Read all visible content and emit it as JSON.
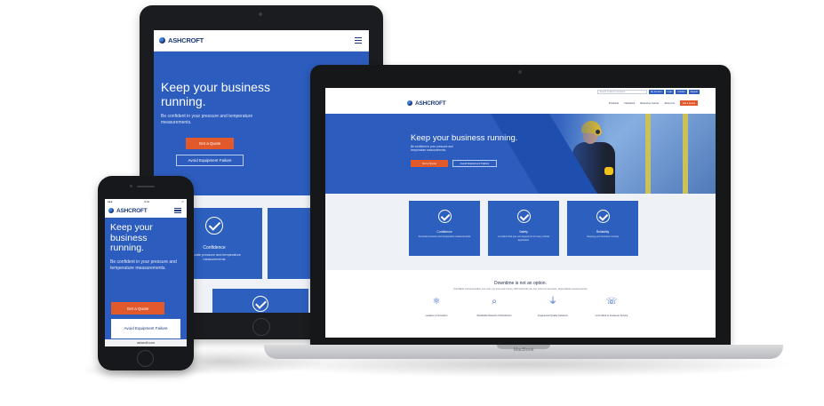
{
  "brand": {
    "logo_text": "ASHCROFT"
  },
  "hero": {
    "headline": "Keep your business running.",
    "headline_phone": "Keep your business running.",
    "subtext": "Be confident in your pressure and temperature measurements.",
    "cta_primary": "Get a Quote",
    "cta_secondary": "Avoid Equipment Failure"
  },
  "laptop_nav": {
    "search_placeholder": "Search product or keyword",
    "top_buttons": [
      "My Account",
      "Login",
      "Contact",
      "Support"
    ],
    "menu": [
      "Products",
      "Industries",
      "Resource Center",
      "About Us"
    ],
    "menu_cta": "Get a Quote"
  },
  "cards": [
    {
      "title": "Confidence",
      "desc": "Accurate pressure and temperature measurements"
    },
    {
      "title": "Safety",
      "desc": "A product that you can depend on for every critical application"
    },
    {
      "title": "Reliability",
      "desc": "Keeping your business running"
    }
  ],
  "downtime": {
    "heading": "Downtime is not an option.",
    "subheading": "Unreliable instrumentation can cost you time and money. With Ashcroft you can count on accurate, dependable measurements.",
    "features": [
      "Leaders in Innovation",
      "Worldwide Network of Distributors",
      "Engineered Quality Solutions",
      "Committed to Customer Service"
    ]
  },
  "phone": {
    "url": "ashcroft.com",
    "status_time": "9:41"
  },
  "laptop_brand": "MacBook",
  "colors": {
    "primary": "#2c5cbd",
    "accent": "#e2592b",
    "dark": "#1c3a78"
  }
}
